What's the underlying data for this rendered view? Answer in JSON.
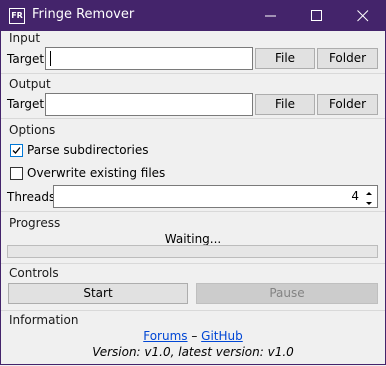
{
  "window": {
    "title": "Fringe Remover",
    "icon_text": "FR"
  },
  "input": {
    "heading": "Input",
    "target_label": "Target:",
    "target_value": "",
    "file_button": "File",
    "folder_button": "Folder"
  },
  "output": {
    "heading": "Output",
    "target_label": "Target:",
    "target_value": "",
    "file_button": "File",
    "folder_button": "Folder"
  },
  "options": {
    "heading": "Options",
    "parse_subdirectories": {
      "label": "Parse subdirectories",
      "checked": true
    },
    "overwrite_existing": {
      "label": "Overwrite existing files",
      "checked": false
    },
    "threads_label": "Threads:",
    "threads_value": "4"
  },
  "progress": {
    "heading": "Progress",
    "status": "Waiting...",
    "fraction": 0
  },
  "controls": {
    "heading": "Controls",
    "start_button": "Start",
    "pause_button": "Pause"
  },
  "information": {
    "heading": "Information",
    "forums_link": "Forums",
    "separator": " – ",
    "github_link": "GitHub",
    "version_text": "Version: v1.0, latest version: v1.0"
  },
  "colors": {
    "titlebar": "#44246b",
    "link": "#0046d5",
    "checkbox_accent": "#0078d7"
  }
}
